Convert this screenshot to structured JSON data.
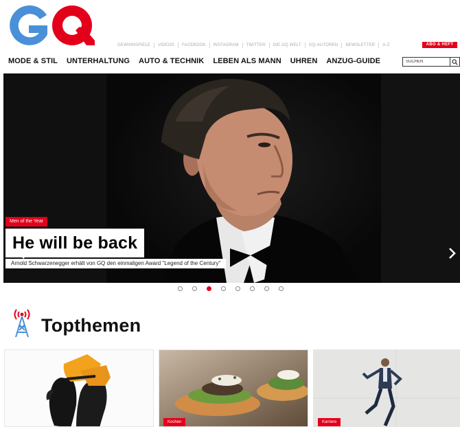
{
  "logo": {
    "text": "GQ",
    "colors": {
      "G": "#4a90d9",
      "Q": "#e3001b"
    }
  },
  "toplinks": [
    "GEWINNSPIELE",
    "VIDEOS",
    "FACEBOOK",
    "INSTAGRAM",
    "TWITTER",
    "DIE GQ WELT",
    "GQ-AUTOREN",
    "NEWSLETTER",
    "A-Z"
  ],
  "abo_label": "ABO & HEFT",
  "nav": [
    "MODE & STIL",
    "UNTERHALTUNG",
    "AUTO & TECHNIK",
    "LEBEN ALS MANN",
    "UHREN",
    "ANZUG-GUIDE"
  ],
  "search": {
    "placeholder": "SUCHEN",
    "icon": "search-icon"
  },
  "hero": {
    "tag": "Men of the Year",
    "title": "He will be back",
    "subtitle": "Arnold Schwarzenegger erhält von GQ den einmaligen Award \"Legend of the Century\"",
    "slide_count": 8,
    "active_slide": 3
  },
  "section": {
    "title": "Topthemen",
    "icon": "broadcast-tower-icon"
  },
  "cards": [
    {
      "tag": "",
      "icon": "gloves-image"
    },
    {
      "tag": "Kochen",
      "icon": "food-image"
    },
    {
      "tag": "Karriere",
      "icon": "running-man-image"
    }
  ],
  "colors": {
    "accent": "#e3001b",
    "logo_blue": "#4a90d9"
  }
}
